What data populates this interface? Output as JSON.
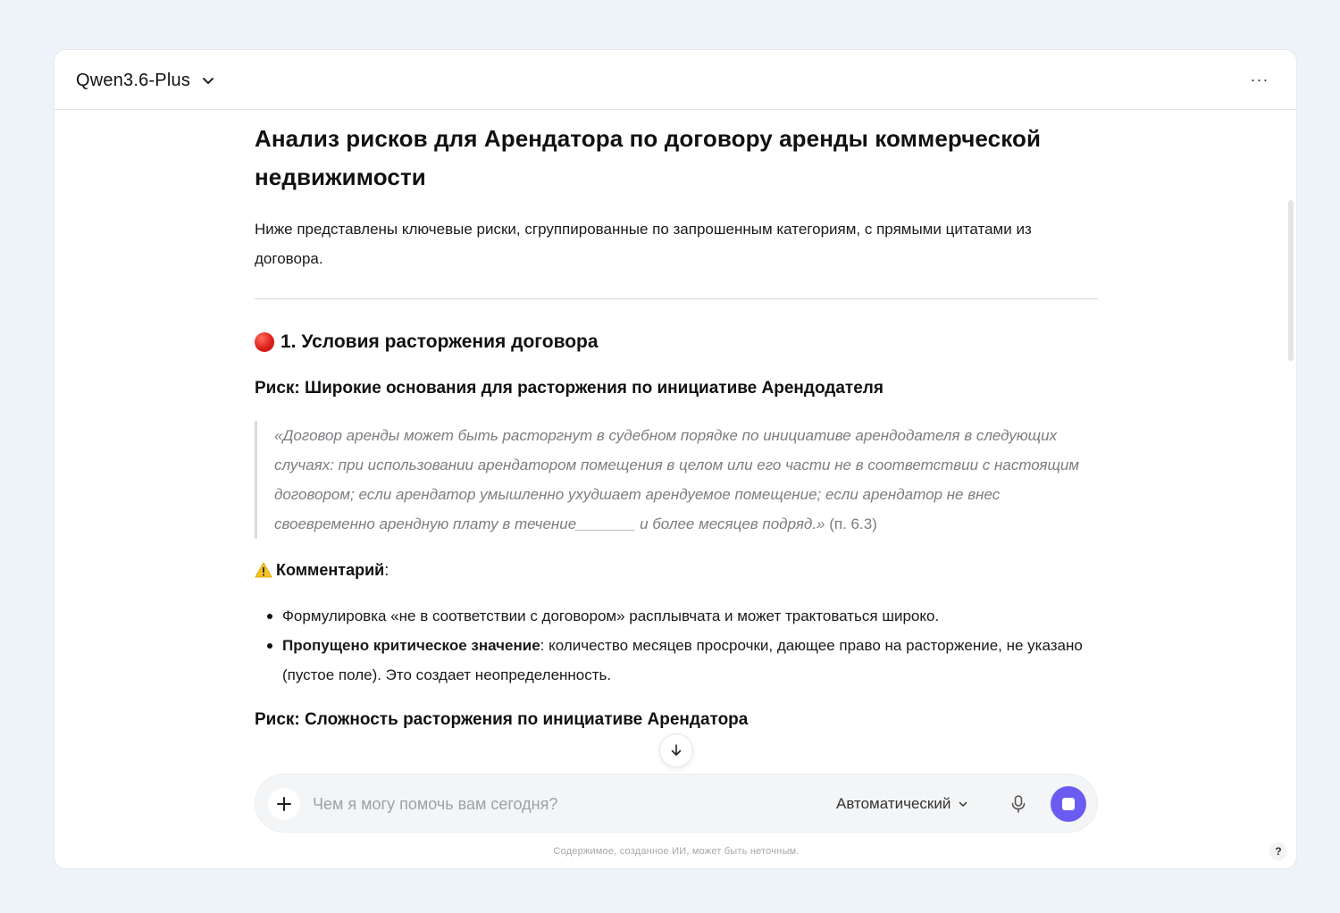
{
  "app": {
    "model_name": "Qwen3.6-Plus",
    "icons": {
      "model_chevron": "chevron-down-icon",
      "more": "more-dots-icon"
    },
    "more_label": "···"
  },
  "article": {
    "title": "Анализ рисков для Арендатора по договору аренды коммерческой недвижимости",
    "intro": "Ниже представлены ключевые риски, сгруппированные по запрошенным категориям, с прямыми цитатами из договора.",
    "section1": {
      "heading": "1. Условия расторжения договора",
      "icon": "red-circle-icon",
      "risk1": {
        "heading": "Риск: Широкие основания для расторжения по инициативе Арендодателя",
        "quote": "«Договор аренды может быть расторгнут в судебном порядке по инициативе арендодателя в следующих случаях: при использовании арендатором помещения в целом или его части не в соответствии с настоящим договором; если арендатор умышленно ухудшает арендуемое помещение; если арендатор не внес своевременно арендную плату в течение_______ и более месяцев подряд.»",
        "quote_ref": " (п. 6.3)",
        "comment_label": "Комментарий",
        "comment_suffix": ":",
        "comment_icon": "warning-icon",
        "bullets": [
          {
            "bold": "",
            "text": "Формулировка «не в соответствии с договором» расплывчата и может трактоваться широко."
          },
          {
            "bold": "Пропущено критическое значение",
            "text": ": количество месяцев просрочки, дающее право на расторжение, не указано (пустое поле). Это создает неопределенность."
          }
        ]
      },
      "risk2": {
        "heading": "Риск: Сложность расторжения по инициативе Арендатора"
      }
    }
  },
  "composer": {
    "placeholder": "Чем я могу помочь вам сегодня?",
    "value": "",
    "mode": "Автоматический",
    "icons": {
      "plus": "plus-icon",
      "mode_chevron": "chevron-down-icon",
      "mic": "microphone-icon",
      "stop": "stop-icon",
      "scroll": "arrow-down-icon"
    }
  },
  "footer": {
    "disclaimer": "Содержимое, созданное ИИ, может быть неточным.",
    "help": "?"
  },
  "colors": {
    "accent": "#6a5cf0",
    "background": "#eef3fa",
    "quote_text": "#7b7d80"
  }
}
